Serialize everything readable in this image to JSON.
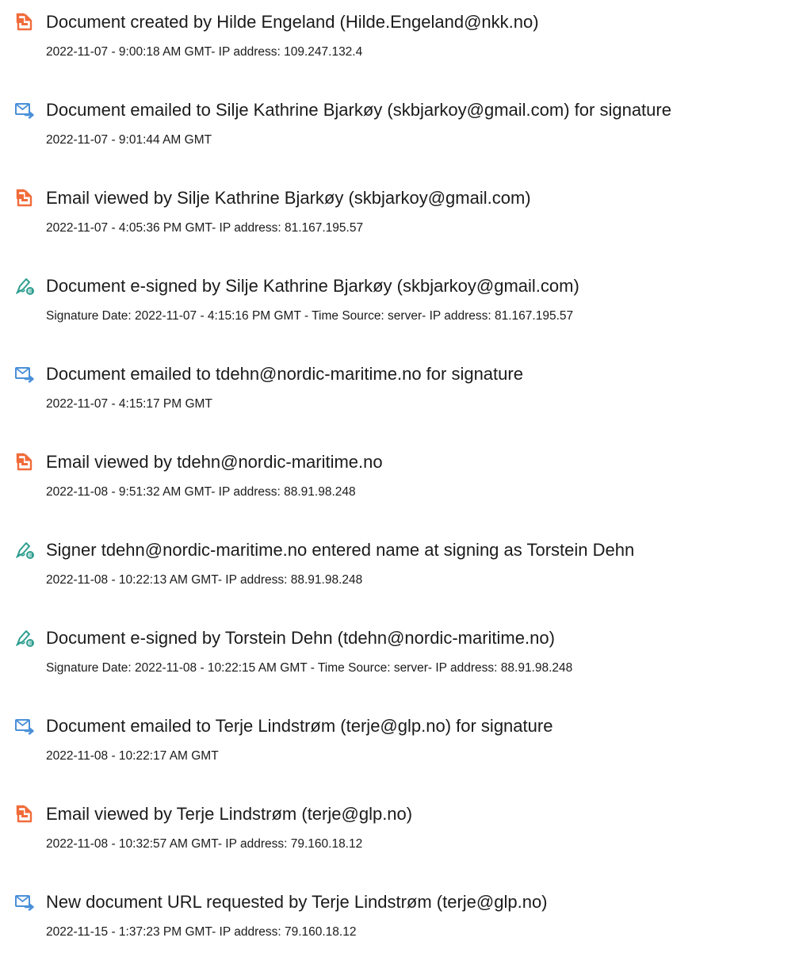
{
  "colors": {
    "created_viewed_icon": "#f26b3a",
    "emailed_icon": "#4a90d9",
    "signed_icon": "#2e9e8f"
  },
  "entries": [
    {
      "icon": "document-icon",
      "title": "Document created by Hilde Engeland (Hilde.Engeland@nkk.no)",
      "detail": "2022-11-07 - 9:00:18 AM GMT- IP address: 109.247.132.4"
    },
    {
      "icon": "email-icon",
      "title": "Document emailed to Silje Kathrine Bjarkøy (skbjarkoy@gmail.com) for signature",
      "detail": "2022-11-07 - 9:01:44 AM GMT"
    },
    {
      "icon": "document-icon",
      "title": "Email viewed by Silje Kathrine Bjarkøy (skbjarkoy@gmail.com)",
      "detail": "2022-11-07 - 4:05:36 PM GMT- IP address: 81.167.195.57"
    },
    {
      "icon": "signature-pen-icon",
      "title": "Document e-signed by Silje Kathrine Bjarkøy (skbjarkoy@gmail.com)",
      "detail": "Signature Date: 2022-11-07 - 4:15:16 PM GMT - Time Source: server- IP address: 81.167.195.57"
    },
    {
      "icon": "email-icon",
      "title": "Document emailed to tdehn@nordic-maritime.no for signature",
      "detail": "2022-11-07 - 4:15:17 PM GMT"
    },
    {
      "icon": "document-icon",
      "title": "Email viewed by tdehn@nordic-maritime.no",
      "detail": "2022-11-08 - 9:51:32 AM GMT- IP address: 88.91.98.248"
    },
    {
      "icon": "signature-pen-icon",
      "title": "Signer tdehn@nordic-maritime.no entered name at signing as Torstein Dehn",
      "detail": "2022-11-08 - 10:22:13 AM GMT- IP address: 88.91.98.248"
    },
    {
      "icon": "signature-pen-icon",
      "title": "Document e-signed by Torstein Dehn (tdehn@nordic-maritime.no)",
      "detail": "Signature Date: 2022-11-08 - 10:22:15 AM GMT - Time Source: server- IP address: 88.91.98.248"
    },
    {
      "icon": "email-icon",
      "title": "Document emailed to Terje Lindstrøm (terje@glp.no) for signature",
      "detail": "2022-11-08 - 10:22:17 AM GMT"
    },
    {
      "icon": "document-icon",
      "title": "Email viewed by Terje Lindstrøm (terje@glp.no)",
      "detail": "2022-11-08 - 10:32:57 AM GMT- IP address: 79.160.18.12"
    },
    {
      "icon": "email-icon",
      "title": "New document URL requested by Terje Lindstrøm (terje@glp.no)",
      "detail": "2022-11-15 - 1:37:23 PM GMT- IP address: 79.160.18.12"
    }
  ]
}
